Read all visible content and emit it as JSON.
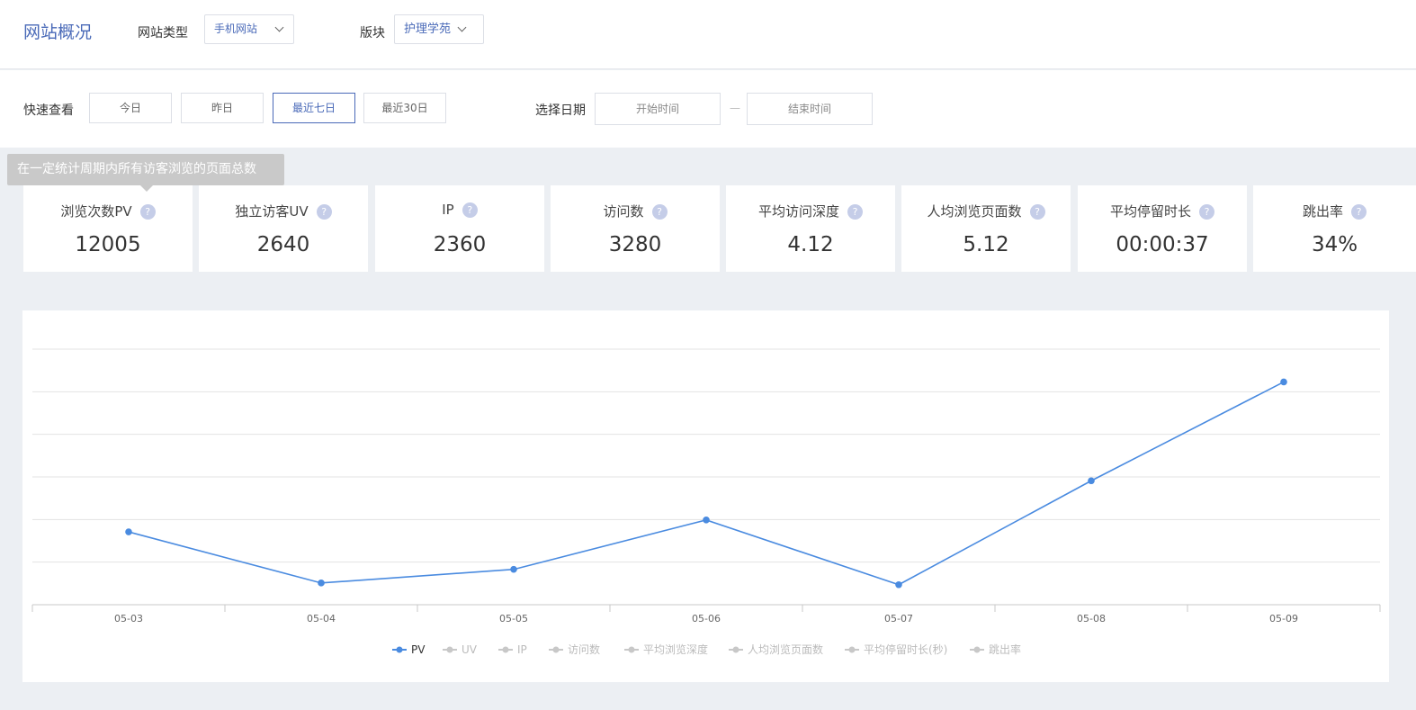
{
  "header": {
    "title": "网站概况",
    "site_type_label": "网站类型",
    "site_type_value": "手机网站",
    "section_label": "版块",
    "section_value": "护理学苑"
  },
  "filters": {
    "quick_label": "快速查看",
    "quick_buttons": [
      "今日",
      "昨日",
      "最近七日",
      "最近30日"
    ],
    "active_quick": "最近七日",
    "date_label": "选择日期",
    "start_placeholder": "开始时间",
    "end_placeholder": "结束时间",
    "separator": "—"
  },
  "tooltip": "在一定统计周期内所有访客浏览的页面总数",
  "metrics": [
    {
      "label": "浏览次数PV",
      "value": "12005"
    },
    {
      "label": "独立访客UV",
      "value": "2640"
    },
    {
      "label": "IP",
      "value": "2360"
    },
    {
      "label": "访问数",
      "value": "3280"
    },
    {
      "label": "平均访问深度",
      "value": "4.12"
    },
    {
      "label": "人均浏览页面数",
      "value": "5.12"
    },
    {
      "label": "平均停留时长",
      "value": "00:00:37"
    },
    {
      "label": "跳出率",
      "value": "34%"
    }
  ],
  "help_glyph": "?",
  "colors": {
    "accent": "#4a6ab8",
    "line": "#4a8be0",
    "inactive": "#c8c8c8"
  },
  "chart_data": {
    "type": "line",
    "categories": [
      "05-03",
      "05-04",
      "05-05",
      "05-06",
      "05-07",
      "05-08",
      "05-09"
    ],
    "series": [
      {
        "name": "PV",
        "values": [
          1710,
          510,
          830,
          1990,
          470,
          2910,
          5230
        ],
        "visible": true
      }
    ],
    "legend": [
      "PV",
      "UV",
      "IP",
      "访问数",
      "平均浏览深度",
      "人均浏览页面数",
      "平均停留时长(秒)",
      "跳出率"
    ],
    "legend_placement": "bottom-center",
    "ylim": [
      0,
      6000
    ],
    "y_gridlines": [
      1000,
      2000,
      3000,
      4000,
      5000,
      6000
    ],
    "y_tick_labels_shown": false,
    "grid": true
  }
}
